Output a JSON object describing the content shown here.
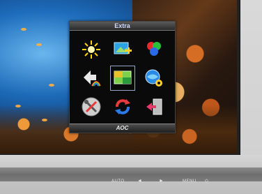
{
  "osd": {
    "title": "Extra",
    "footer_logo": "AOC",
    "items": [
      {
        "icon": "brightness-sun-icon"
      },
      {
        "icon": "picture-add-icon"
      },
      {
        "icon": "color-circles-icon"
      },
      {
        "icon": "rainbow-arrow-icon"
      },
      {
        "icon": "picture-boost-icon"
      },
      {
        "icon": "globe-settings-icon"
      },
      {
        "icon": "wrench-screwdriver-icon"
      },
      {
        "icon": "refresh-reset-icon"
      },
      {
        "icon": "exit-door-icon"
      }
    ]
  },
  "bezel_buttons": {
    "auto": "AUTO",
    "left": "◄",
    "right": "►",
    "menu": "MENU",
    "power": "⏻"
  }
}
